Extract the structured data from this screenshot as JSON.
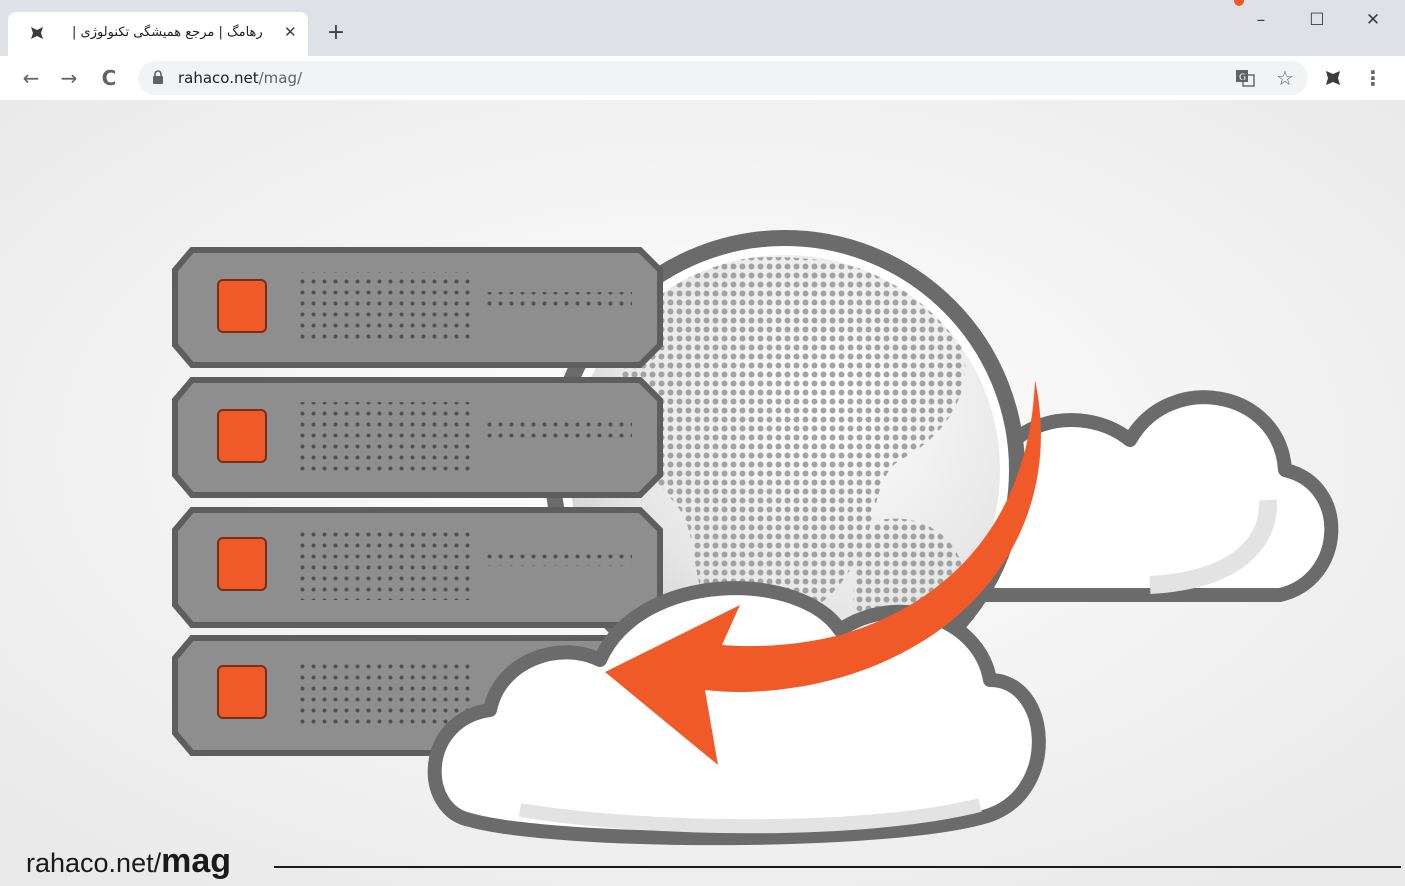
{
  "browser": {
    "tab": {
      "title": "رهامگ | مرجع همیشگی تکنولوژی |",
      "close_symbol": "✕"
    },
    "new_tab_symbol": "+",
    "window_controls": {
      "minimize": "–",
      "maximize": "☐",
      "close": "✕"
    },
    "nav": {
      "back": "←",
      "forward": "→",
      "reload": "C"
    },
    "address": {
      "host": "rahaco.net",
      "path": "/mag/"
    },
    "toolbar_icons": [
      "translate-icon",
      "star-icon",
      "rahaco-extension-icon",
      "menu-icon"
    ],
    "star_symbol": "☆",
    "menu_symbol": "⋮"
  },
  "illustration": {
    "subject": "server-globe-cloud-migration",
    "colors": {
      "server_body": "#8e8e8e",
      "server_outline": "#6b6b6b",
      "led": "#f05a28",
      "arrow": "#f05a28",
      "cloud_fill": "#ffffff",
      "cloud_outline": "#6b6b6b",
      "globe_outline": "#6b6b6b",
      "background": "#f4f4f4"
    },
    "server_count": 4
  },
  "watermark": {
    "prefix": "rahaco.net/",
    "emphasis": "mag"
  }
}
